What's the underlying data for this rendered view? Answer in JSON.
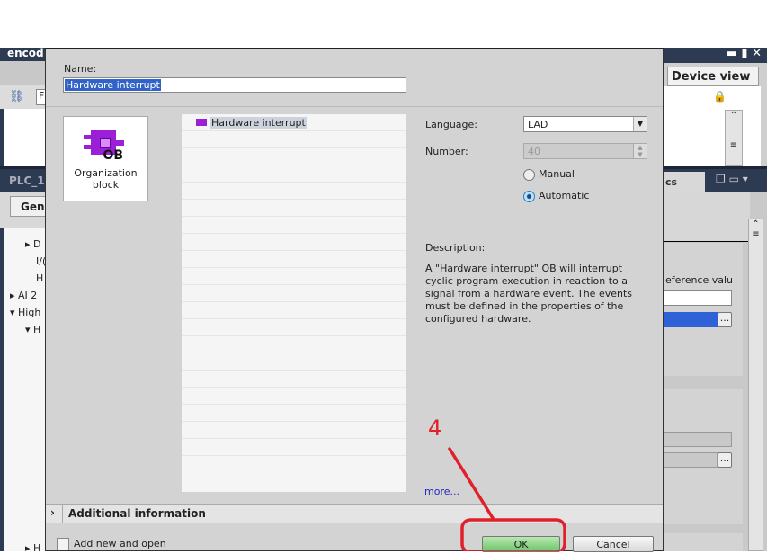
{
  "background": {
    "left": {
      "title": "encod",
      "toolbar_input": "F",
      "panel_title": "PLC_1",
      "tab": "Gen",
      "tree": [
        "D",
        "I/(",
        "H",
        "AI 2",
        "High",
        "H",
        "H"
      ]
    },
    "right": {
      "tab": "Device view",
      "panel_tab": "cs",
      "field_label": "eference valu",
      "browse": "..."
    }
  },
  "dialog": {
    "name_label": "Name:",
    "name_value": "Hardware interrupt",
    "block_type": {
      "label": "Organization block",
      "icon_text": "OB"
    },
    "list": {
      "items": [
        "Hardware interrupt"
      ]
    },
    "language_label": "Language:",
    "language_value": "LAD",
    "number_label": "Number:",
    "number_value": "40",
    "radio": [
      {
        "label": "Manual",
        "checked": false
      },
      {
        "label": "Automatic",
        "checked": true
      }
    ],
    "description_label": "Description:",
    "description": "A \"Hardware interrupt\" OB will interrupt cyclic program execution in reaction to a signal from a hardware event. The events must be defined in the properties of the configured hardware.",
    "more_link": "more...",
    "additional_info": "Additional  information",
    "add_new_open": "Add new and open",
    "ok": "OK",
    "cancel": "Cancel"
  },
  "annotation": {
    "step": "4",
    "color": "#e0202a"
  }
}
